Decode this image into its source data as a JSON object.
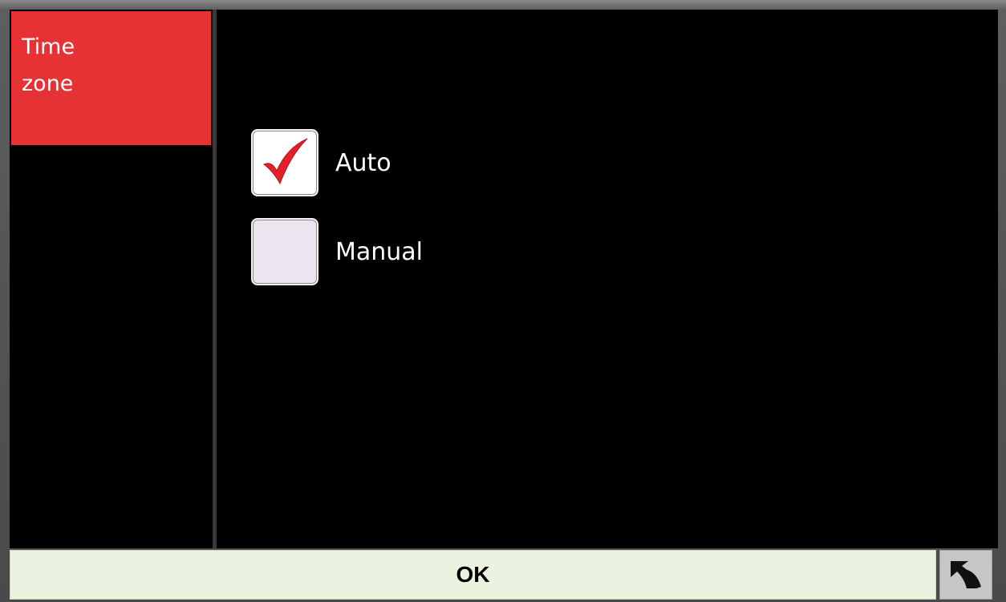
{
  "sidebar": {
    "items": [
      {
        "label_line1": "Time",
        "label_line2": "zone",
        "selected": true
      }
    ]
  },
  "main": {
    "options": [
      {
        "label": "Auto",
        "checked": true
      },
      {
        "label": "Manual",
        "checked": false
      }
    ]
  },
  "footer": {
    "ok_label": "OK",
    "back_icon": "undo-arrow-icon"
  },
  "colors": {
    "accent": "#e63234",
    "check_mark": "#e3202a",
    "ok_button_bg": "#eaf3e0",
    "background": "#000000"
  }
}
